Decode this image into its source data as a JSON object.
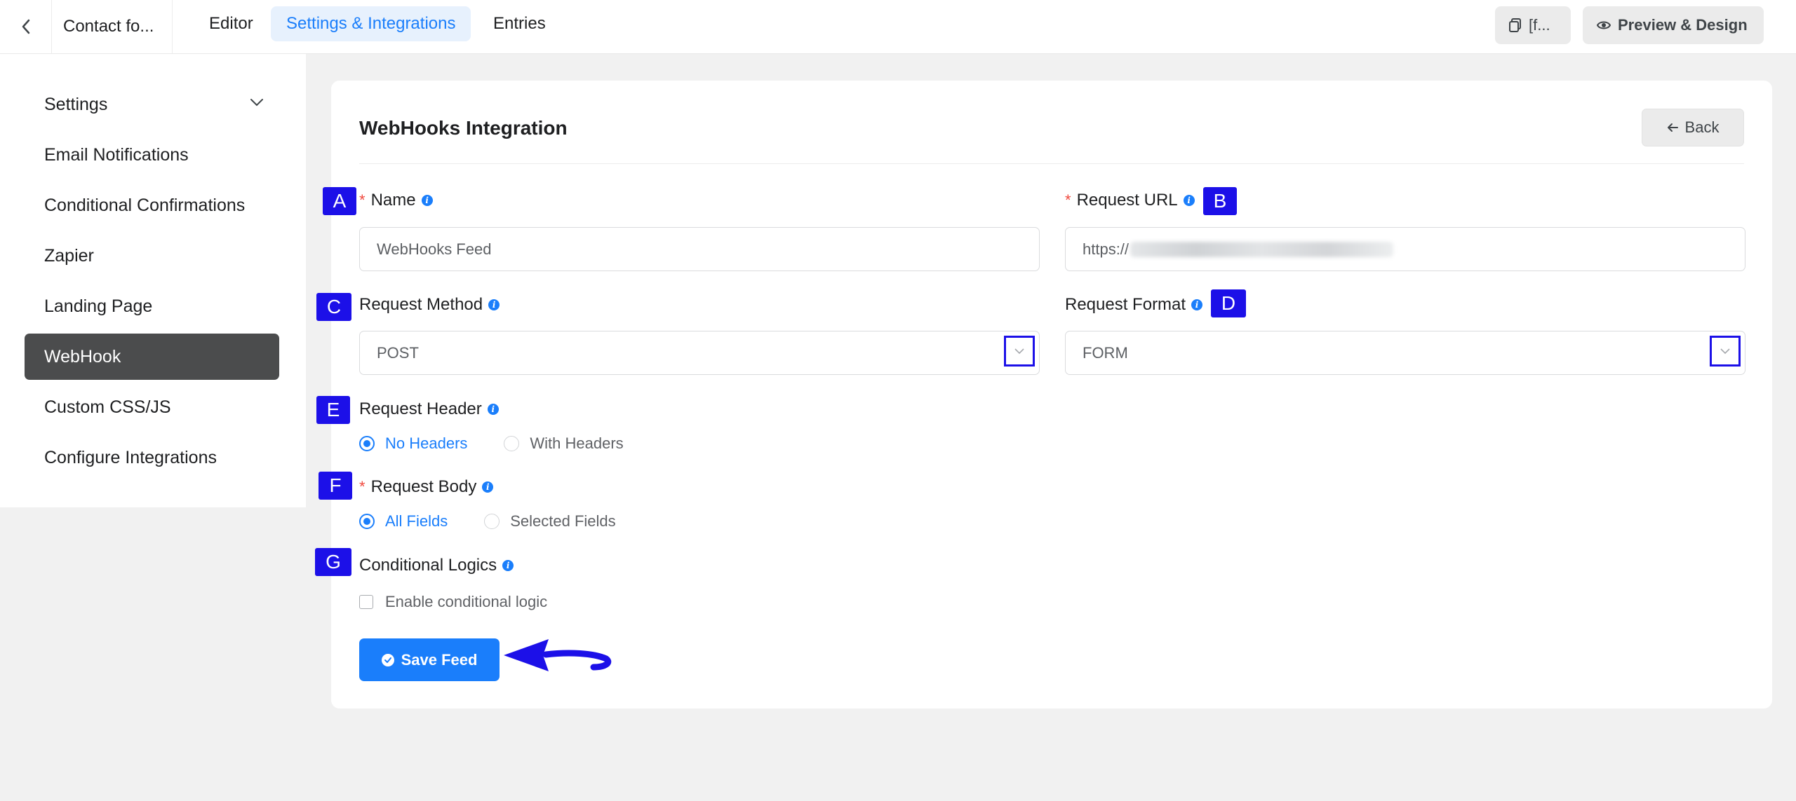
{
  "topbar": {
    "form_title": "Contact fo...",
    "tabs": [
      {
        "label": "Editor",
        "active": false
      },
      {
        "label": "Settings & Integrations",
        "active": true
      },
      {
        "label": "Entries",
        "active": false
      }
    ],
    "shortcode_label": "[f...",
    "preview_label": "Preview & Design"
  },
  "sidebar": {
    "items": [
      {
        "label": "Settings",
        "active": false
      },
      {
        "label": "Email Notifications",
        "active": false
      },
      {
        "label": "Conditional Confirmations",
        "active": false
      },
      {
        "label": "Zapier",
        "active": false
      },
      {
        "label": "Landing Page",
        "active": false
      },
      {
        "label": "WebHook",
        "active": true
      },
      {
        "label": "Custom CSS/JS",
        "active": false
      },
      {
        "label": "Configure Integrations",
        "active": false
      }
    ]
  },
  "card": {
    "title": "WebHooks Integration",
    "back_label": "Back"
  },
  "form": {
    "name": {
      "label": "Name",
      "value": "WebHooks Feed"
    },
    "request_url": {
      "label": "Request URL",
      "value": "https://"
    },
    "request_method": {
      "label": "Request Method",
      "value": "POST"
    },
    "request_format": {
      "label": "Request Format",
      "value": "FORM"
    },
    "request_header": {
      "label": "Request Header",
      "options": [
        "No Headers",
        "With Headers"
      ],
      "selected": "No Headers"
    },
    "request_body": {
      "label": "Request Body",
      "options": [
        "All Fields",
        "Selected Fields"
      ],
      "selected": "All Fields"
    },
    "conditional_logics": {
      "label": "Conditional Logics",
      "checkbox_label": "Enable conditional logic",
      "checked": false
    },
    "save_label": "Save Feed"
  },
  "annotations": {
    "badges": [
      "A",
      "B",
      "C",
      "D",
      "E",
      "F",
      "G"
    ],
    "color": "#1c10e8"
  },
  "colors": {
    "accent": "#1a7efb",
    "required": "#f0493e",
    "sidebar_active": "#4b4c4d"
  }
}
